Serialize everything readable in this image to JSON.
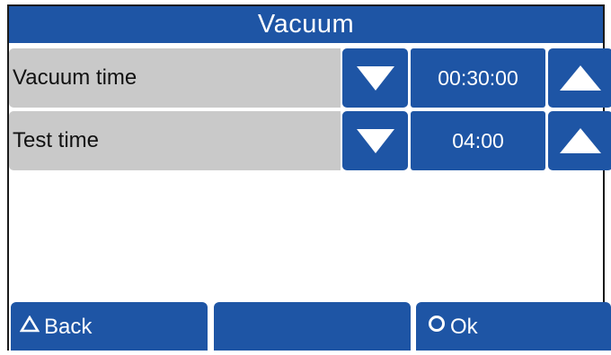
{
  "screen": {
    "title": "Vacuum"
  },
  "settings": [
    {
      "label": "Vacuum time",
      "value": "00:30:00",
      "decrease_icon": "triangle-down-icon",
      "increase_icon": "triangle-up-icon"
    },
    {
      "label": "Test time",
      "value": "04:00",
      "decrease_icon": "triangle-down-icon",
      "increase_icon": "triangle-up-icon"
    }
  ],
  "footer": {
    "back_label": "Back",
    "back_icon": "triangle-outline-icon",
    "middle_label": "",
    "ok_label": "Ok",
    "ok_icon": "circle-outline-icon"
  },
  "colors": {
    "accent_blue": "#1e55a5",
    "label_gray": "#c9c9c9",
    "background": "#ffffff"
  }
}
